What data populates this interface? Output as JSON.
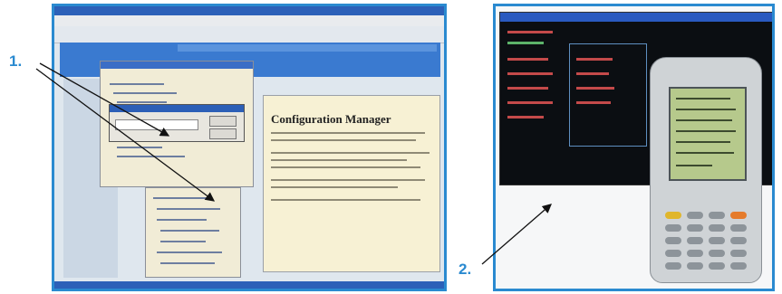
{
  "callouts": {
    "label_1": "1.",
    "label_2": "2."
  },
  "panel1": {
    "description_icons": [
      "titlebar",
      "menubar",
      "toolbar",
      "tree-view",
      "dialog",
      "document-pane"
    ],
    "document_title": "Configuration Manager"
  },
  "panel2": {
    "description_icons": [
      "terminal-window",
      "handheld-scanner"
    ]
  },
  "colors": {
    "accent": "#2a8ad0",
    "window_blue": "#2c60b8",
    "doc_pane": "#f7f1d4",
    "terminal_bg": "#0b0e12"
  }
}
